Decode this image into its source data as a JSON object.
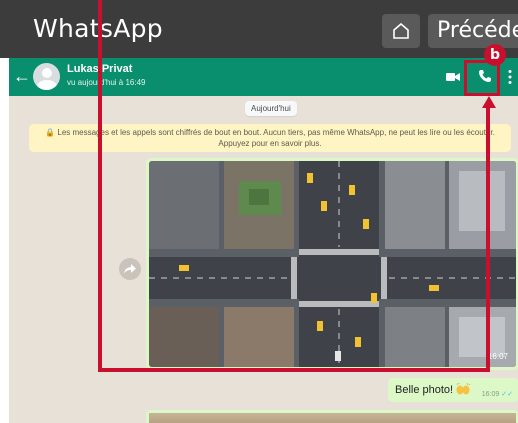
{
  "app": {
    "title": "WhatsApp",
    "nav": {
      "home_icon": "home-icon",
      "prev_label": "Précédent"
    }
  },
  "chat_header": {
    "contact_name": "Lukas Privat",
    "status": "vu aujourd'hui à 16:49",
    "icons": [
      "back-arrow-icon",
      "avatar",
      "video-call-icon",
      "phone-call-icon",
      "more-options-icon"
    ]
  },
  "chat": {
    "date_chip": "Aujourd'hui",
    "encryption_notice": "Les messages et les appels sont chiffrés de bout en bout. Aucun tiers, pas même WhatsApp, ne peut les lire ou les écouter. Appuyez pour en savoir plus.",
    "messages": [
      {
        "type": "image",
        "caption": "",
        "time": "16:07"
      },
      {
        "type": "text",
        "text": "Belle photo!",
        "emoji": "raising-hands",
        "time": "16:09"
      }
    ]
  },
  "annotation": {
    "badge": "b",
    "color": "#c8102e"
  },
  "colors": {
    "header": "#0a8f6e",
    "chat_bg": "#e8e1d7",
    "bubble": "#dcf8c6",
    "notice": "#fff5c4",
    "topbar": "#3c3c3c"
  }
}
